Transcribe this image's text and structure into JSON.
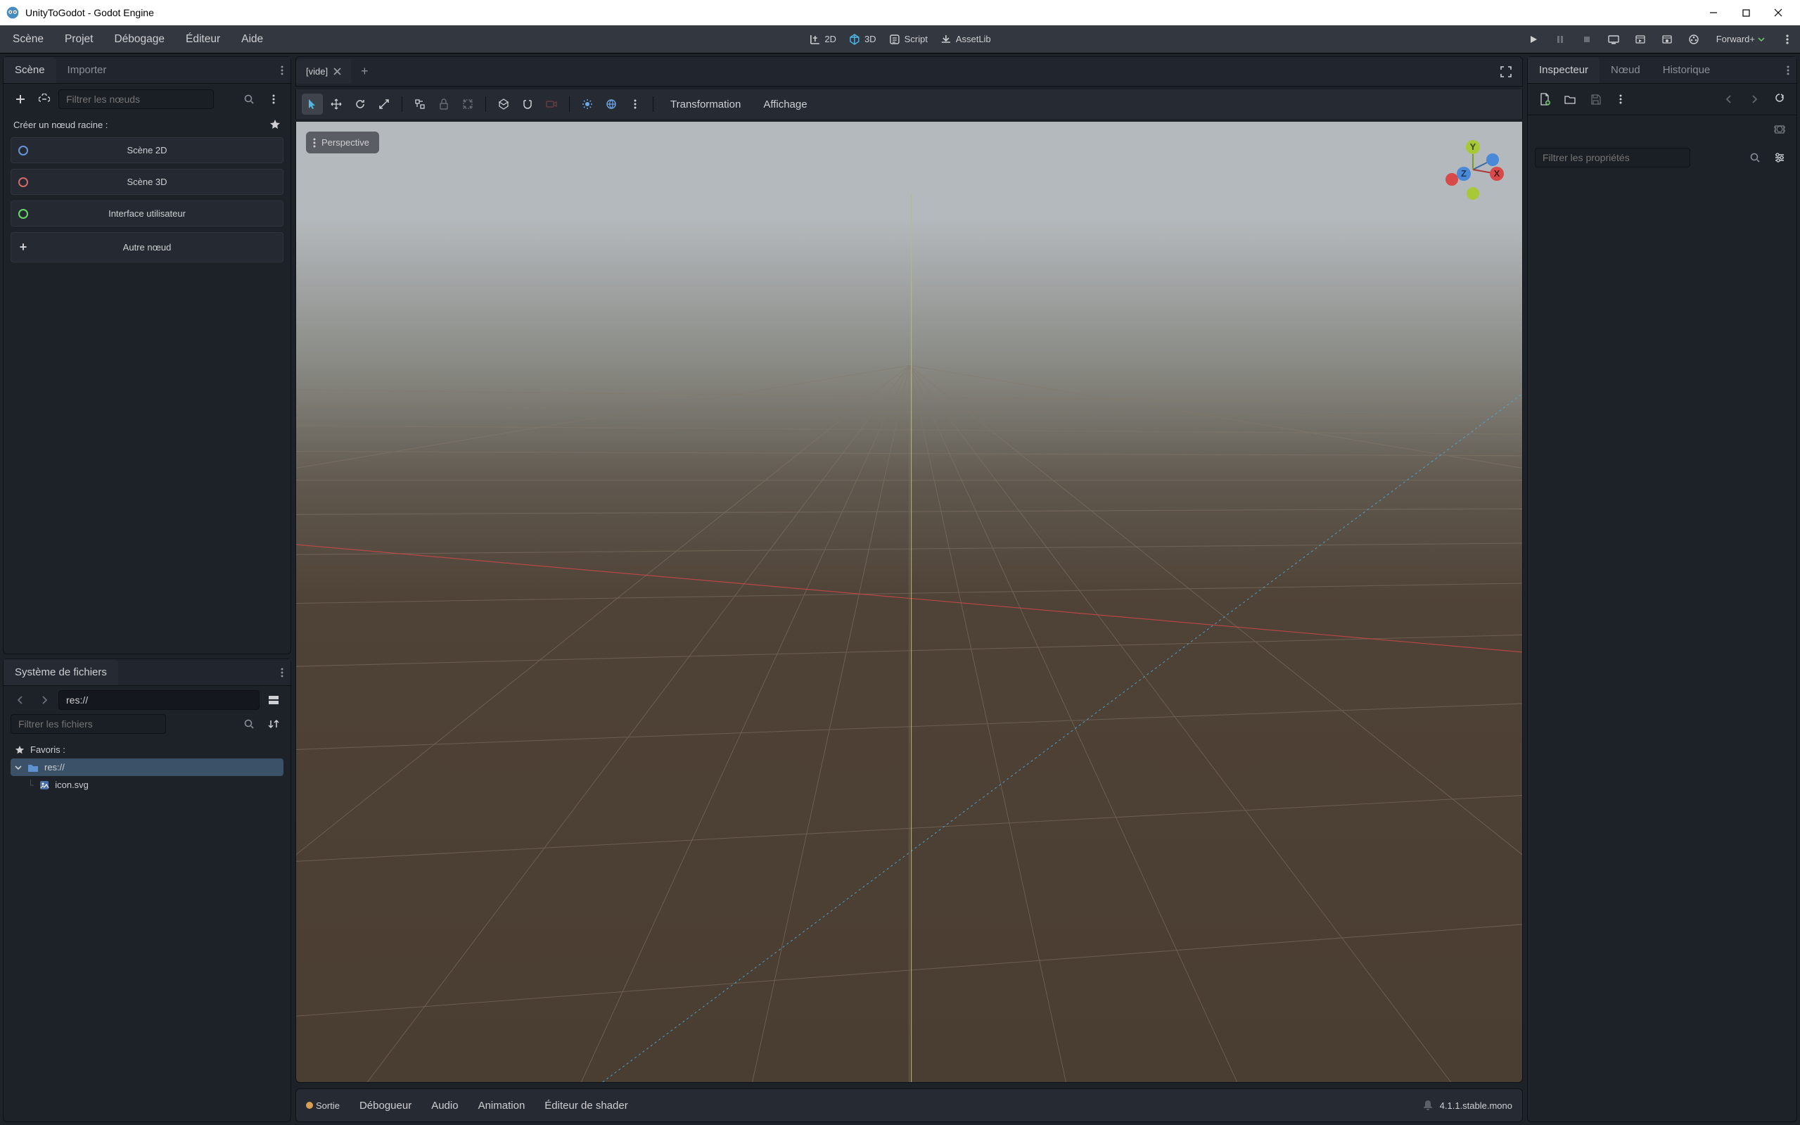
{
  "window": {
    "title": "UnityToGodot - Godot Engine"
  },
  "menubar": {
    "items": [
      "Scène",
      "Projet",
      "Débogage",
      "Éditeur",
      "Aide"
    ],
    "center": {
      "d2": "2D",
      "d3": "3D",
      "script": "Script",
      "assetlib": "AssetLib"
    },
    "renderer": "Forward+"
  },
  "scene_panel": {
    "tabs": {
      "scene": "Scène",
      "import": "Importer"
    },
    "filter_placeholder": "Filtrer les nœuds",
    "root_label": "Créer un nœud racine :",
    "buttons": {
      "s2d": "Scène 2D",
      "s3d": "Scène 3D",
      "ui": "Interface utilisateur",
      "other": "Autre nœud"
    }
  },
  "fs_panel": {
    "title": "Système de fichiers",
    "path": "res://",
    "filter_placeholder": "Filtrer les fichiers",
    "favorites": "Favoris :",
    "tree": {
      "root": "res://",
      "file": "icon.svg"
    }
  },
  "viewport": {
    "tab": "[vide]",
    "perspective": "Perspective",
    "transform": "Transformation",
    "display": "Affichage",
    "axes": {
      "x": "X",
      "y": "Y",
      "z": "Z"
    }
  },
  "bottom": {
    "tabs": [
      "Sortie",
      "Débogueur",
      "Audio",
      "Animation",
      "Éditeur de shader"
    ],
    "version": "4.1.1.stable.mono"
  },
  "inspector": {
    "tabs": {
      "insp": "Inspecteur",
      "node": "Nœud",
      "history": "Historique"
    },
    "filter_placeholder": "Filtrer les propriétés"
  }
}
